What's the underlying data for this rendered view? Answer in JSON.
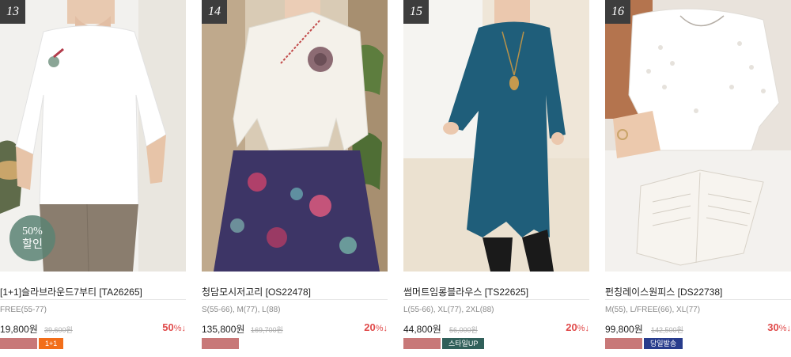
{
  "products": [
    {
      "rank": "13",
      "name": "[1+1]슬라브라운드7부티 [TA26265]",
      "sizes": "FREE(55-77)",
      "price": "19,800원",
      "original_price": "39,600원",
      "discount_number": "50",
      "discount_suffix": "%↓",
      "badge_line1": "50%",
      "badge_line2": "할인",
      "tag": "1+1",
      "tag_color": "#f26e1a"
    },
    {
      "rank": "14",
      "name": "청담모시저고리 [OS22478]",
      "sizes": "S(55-66), M(77), L(88)",
      "price": "135,800원",
      "original_price": "169,700원",
      "discount_number": "20",
      "discount_suffix": "%↓",
      "tag": "",
      "tag_color": ""
    },
    {
      "rank": "15",
      "name": "썸머트임롱블라우스 [TS22625]",
      "sizes": "L(55-66), XL(77), 2XL(88)",
      "price": "44,800원",
      "original_price": "56,000원",
      "discount_number": "20",
      "discount_suffix": "%↓",
      "tag": "스타일UP",
      "tag_color": "#31605a"
    },
    {
      "rank": "16",
      "name": "펀칭레이스원피스 [DS22738]",
      "sizes": "M(55), L/FREE(66), XL(77)",
      "price": "99,800원",
      "original_price": "142,500원",
      "discount_number": "30",
      "discount_suffix": "%↓",
      "tag": "당일발송",
      "tag_color": "#283c8c"
    }
  ],
  "colors": {
    "discount": "#e04a4a",
    "swatch": "#c87878",
    "rank_bg": "#3d3d3d"
  }
}
